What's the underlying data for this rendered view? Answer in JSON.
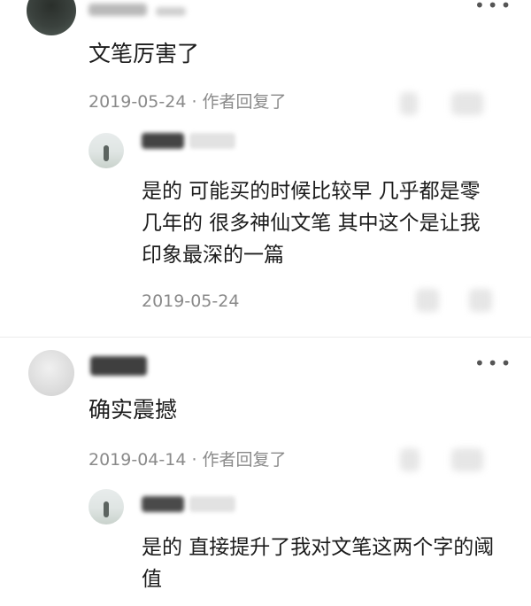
{
  "comments": [
    {
      "text": "文笔厉害了",
      "meta": "2019-05-24 · 作者回复了",
      "reply": {
        "text": "是的 可能买的时候比较早 几乎都是零几年的 很多神仙文笔 其中这个是让我印象最深的一篇",
        "date": "2019-05-24"
      }
    },
    {
      "text": "确实震撼",
      "meta": "2019-04-14 · 作者回复了",
      "reply": {
        "text": "是的 直接提升了我对文笔这两个字的阈值"
      }
    }
  ],
  "more_icon": "more-dots-icon",
  "colors": {
    "text": "#1c1c1c",
    "meta": "#8a8a8a",
    "background": "#ffffff"
  }
}
